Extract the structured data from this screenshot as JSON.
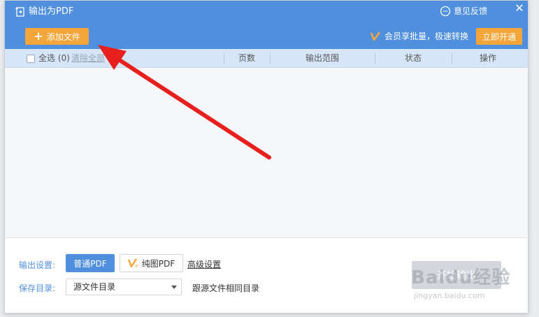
{
  "window": {
    "title": "输出为PDF",
    "feedback_label": "意见反馈",
    "close_glyph": "✕"
  },
  "toolbar": {
    "add_file_label": "添加文件",
    "add_file_icon": "plus-icon",
    "vip_text": "会员享批量，极速转换",
    "open_vip_label": "立即开通"
  },
  "table": {
    "select_all_label": "全选",
    "count": "(0)",
    "clear_all_label": "清除全部",
    "columns": [
      "页数",
      "输出范围",
      "状态",
      "操作"
    ]
  },
  "footer": {
    "output_settings_label": "输出设置:",
    "normal_pdf_label": "普通PDF",
    "image_pdf_label": "纯图PDF",
    "advanced_settings_label": "高级设置",
    "save_dir_label": "保存目录:",
    "save_dir_value": "源文件目录",
    "save_dir_note": "跟源文件相同目录",
    "start_button_label": "开始输出"
  },
  "watermark": {
    "text": "Baidu经验",
    "sub": "jingyan.baidu.com"
  },
  "colors": {
    "header": "#4f8fde",
    "accent_orange": "#f4a63a",
    "table_header": "#d6e6f8",
    "annotation_arrow": "#e8201d"
  }
}
